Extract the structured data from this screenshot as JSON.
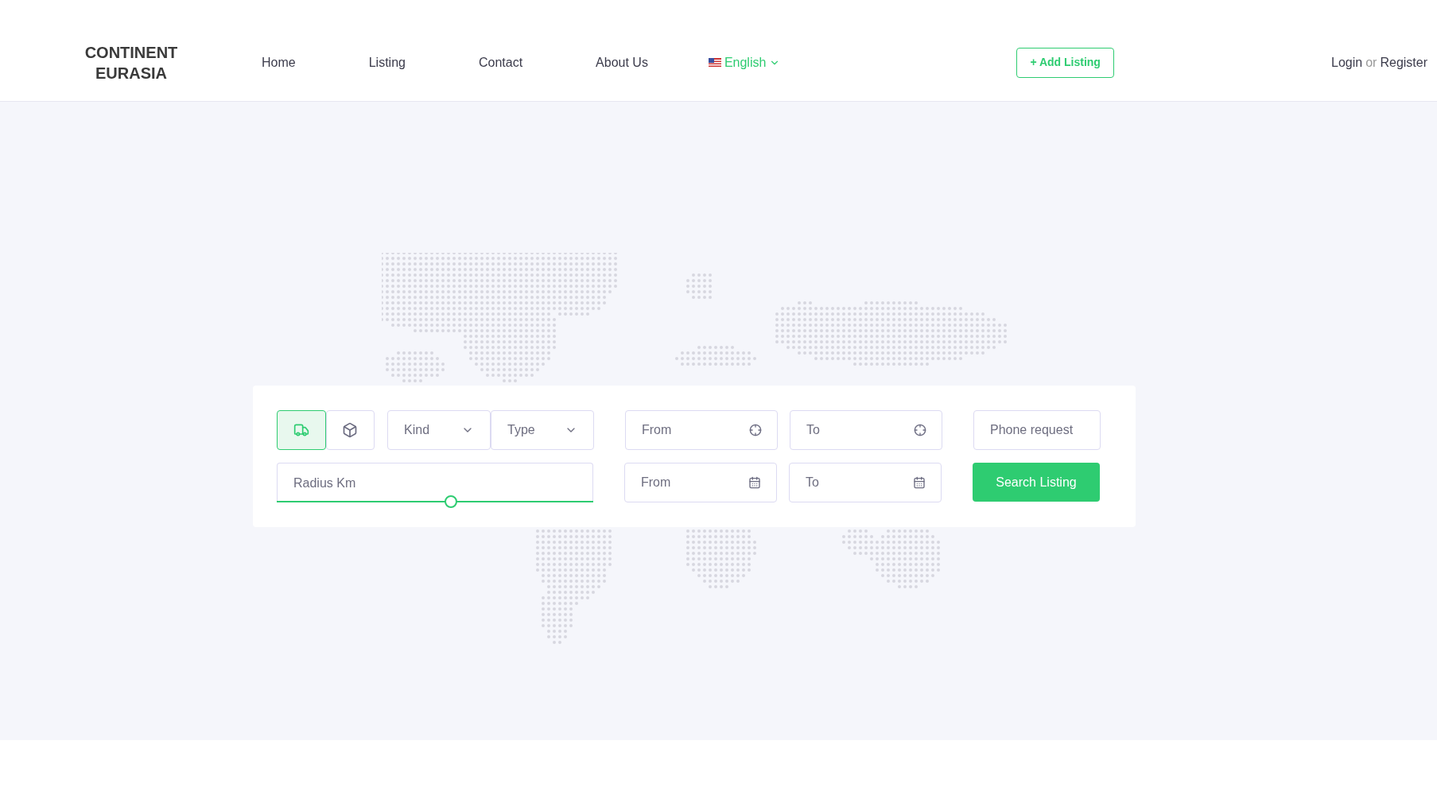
{
  "header": {
    "logo": [
      "CONTINENT",
      "EURASIA"
    ],
    "nav": [
      {
        "label": "Home",
        "selected": false
      },
      {
        "label": "Listing",
        "selected": false
      },
      {
        "label": "Contact",
        "selected": false
      },
      {
        "label": "About Us",
        "selected": false
      }
    ],
    "language": {
      "label": "English"
    },
    "add_listing": "+ Add Listing",
    "auth": {
      "login": "Login",
      "separator": "or",
      "register": "Register"
    }
  },
  "search": {
    "modes": [
      {
        "kind": "truck",
        "selected": true
      },
      {
        "kind": "box",
        "selected": false
      }
    ],
    "selects": [
      {
        "placeholder": "Kind"
      },
      {
        "placeholder": "Type"
      }
    ],
    "locations": [
      {
        "placeholder": "From"
      },
      {
        "placeholder": "To"
      }
    ],
    "dates": [
      {
        "placeholder": "From"
      },
      {
        "placeholder": "To"
      }
    ],
    "phone": {
      "placeholder": "Phone request"
    },
    "radius": {
      "placeholder": "Radius Km",
      "level": 0.55
    },
    "submit": "Search Listing"
  }
}
